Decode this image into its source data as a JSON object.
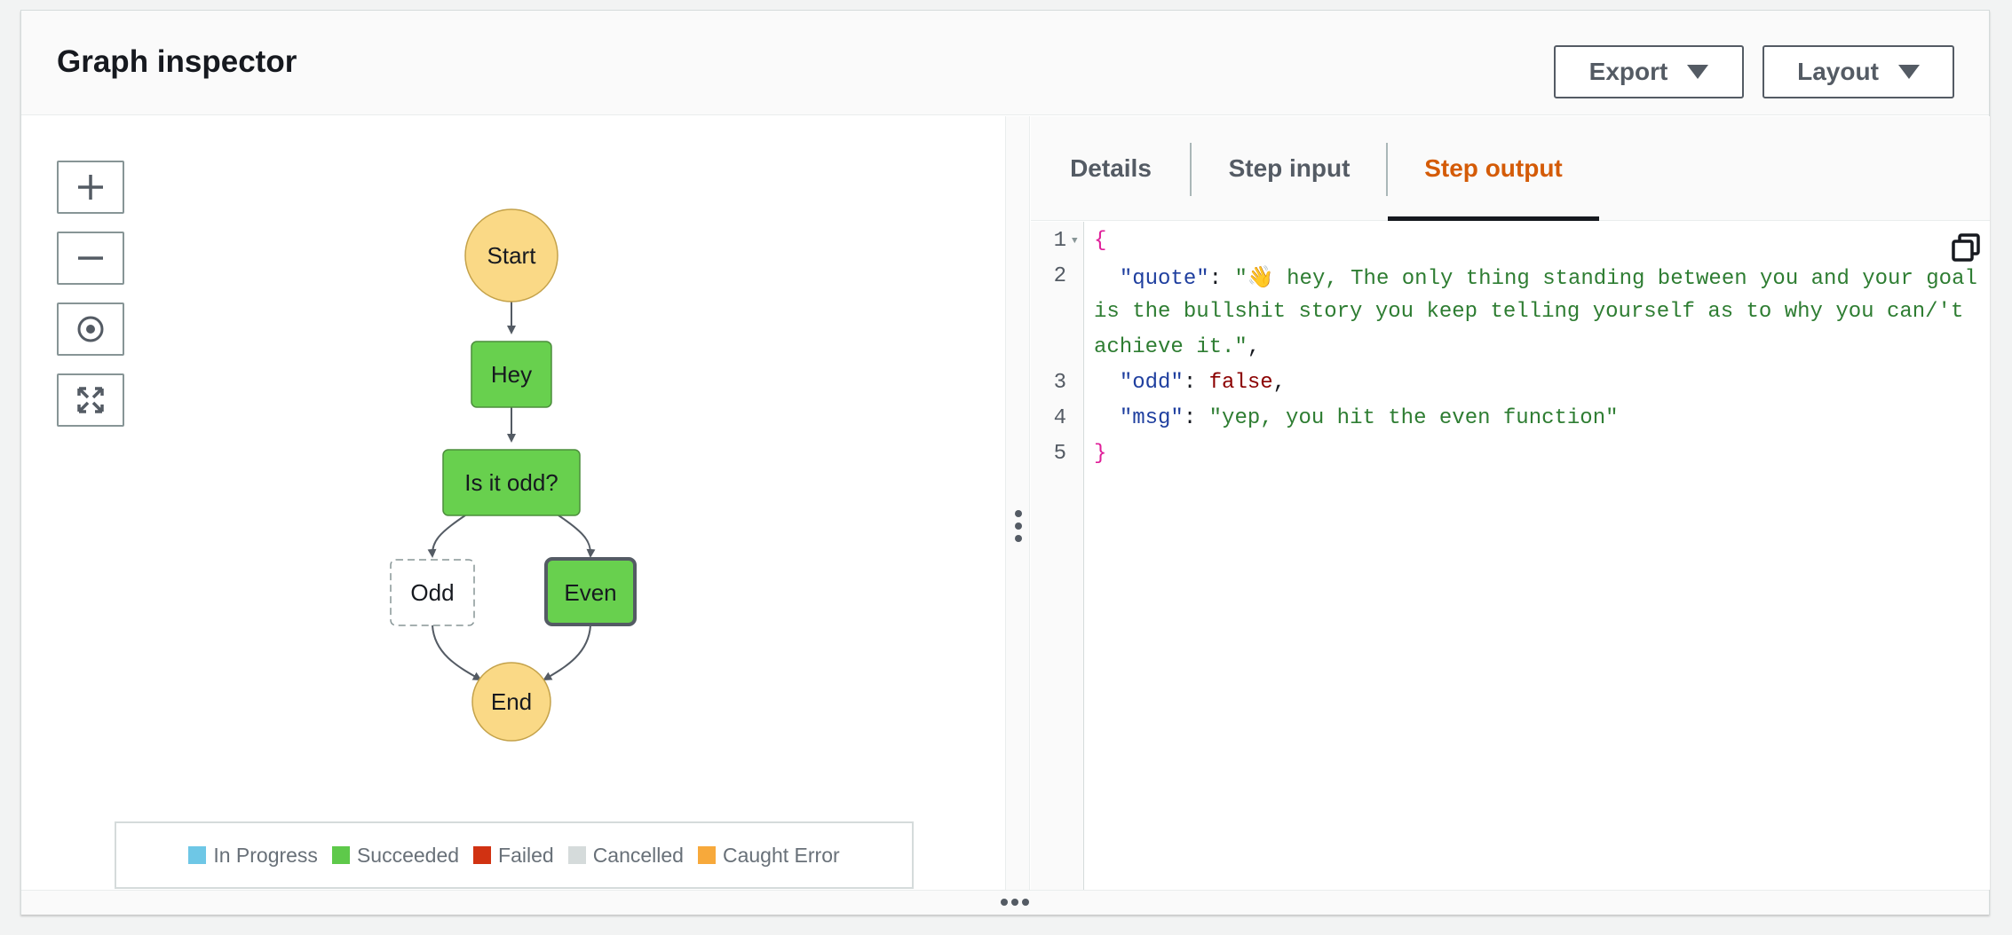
{
  "header": {
    "title": "Graph inspector",
    "export_label": "Export",
    "layout_label": "Layout"
  },
  "zoom_controls": {
    "icons": [
      "plus-icon",
      "minus-icon",
      "center-icon",
      "fit-to-screen-icon"
    ]
  },
  "graph": {
    "nodes": {
      "start": "Start",
      "hey": "Hey",
      "is_odd": "Is it odd?",
      "odd": "Odd",
      "even": "Even",
      "end": "End"
    },
    "colors": {
      "terminal_fill": "#fad986",
      "terminal_stroke": "#c4a24a",
      "succeeded_fill": "#68d04e",
      "succeeded_stroke": "#4c8d3c",
      "edge": "#545b64"
    }
  },
  "legend": {
    "items": [
      {
        "label": "In Progress",
        "color": "#6ec7e6"
      },
      {
        "label": "Succeeded",
        "color": "#5ec94a"
      },
      {
        "label": "Failed",
        "color": "#d13212"
      },
      {
        "label": "Cancelled",
        "color": "#d5dbdb"
      },
      {
        "label": "Caught Error",
        "color": "#f7a93b"
      }
    ]
  },
  "tabs": {
    "details": "Details",
    "step_input": "Step input",
    "step_output": "Step output",
    "active": "step_output"
  },
  "editor": {
    "line_numbers": [
      "1",
      "2",
      "3",
      "4",
      "5"
    ],
    "lines": {
      "open": "{",
      "quote_key": "\"quote\"",
      "quote_val_1": "\"👋 hey, The only thing standing between you and your goal",
      "quote_val_2": "is the bullshit story you keep telling yourself as to why you can/'t",
      "quote_val_3": "achieve it.\"",
      "odd_key": "\"odd\"",
      "odd_val": "false",
      "msg_key": "\"msg\"",
      "msg_val": "\"yep, you hit the even function\"",
      "close": "}"
    }
  }
}
